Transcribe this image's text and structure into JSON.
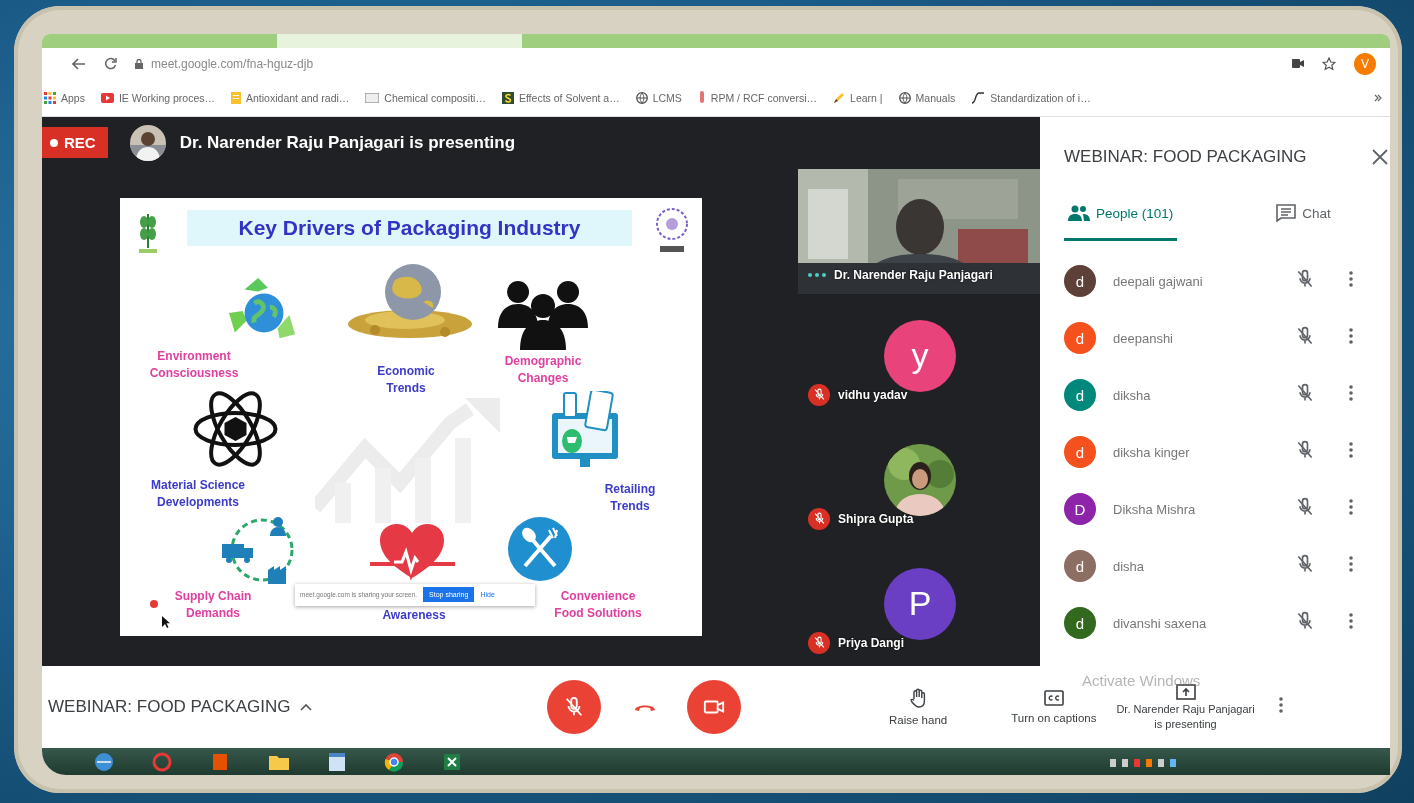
{
  "browser": {
    "address": "meet.google.com/fna-hguz-djb",
    "profile_initial": "V",
    "bookmarks": [
      "Apps",
      "IE Working proces…",
      "Antioxidant and radi…",
      "Chemical compositi…",
      "Effects of Solvent a…",
      "LCMS",
      "RPM / RCF conversi…",
      "Learn |",
      "Manuals",
      "Standardization of i…"
    ]
  },
  "presentation": {
    "rec_label": "REC",
    "banner": "Dr. Narender Raju Panjagari is presenting"
  },
  "slide": {
    "title": "Key Drivers of Packaging Industry",
    "drivers": [
      {
        "label": "Environment\nConsciousness",
        "color": "#e0409f"
      },
      {
        "label": "Economic\nTrends",
        "color": "#3c3cc8"
      },
      {
        "label": "Demographic\nChanges",
        "color": "#e0409f"
      },
      {
        "label": "Material Science\nDevelopments",
        "color": "#3c3cc8"
      },
      {
        "label": "Retailing\nTrends",
        "color": "#3c3cc8"
      },
      {
        "label": "Supply Chain\nDemands",
        "color": "#e0409f"
      },
      {
        "label": "Awareness",
        "color": "#3c3cc8"
      },
      {
        "label": "Convenience\nFood Solutions",
        "color": "#e0409f"
      }
    ],
    "share_notice": {
      "message": "meet.google.com is sharing your screen.",
      "stop_button": "Stop sharing",
      "hide_button": "Hide"
    }
  },
  "tiles": [
    {
      "name": "Dr. Narender Raju Panjagari",
      "kind": "video",
      "muted": false
    },
    {
      "name": "vidhu yadav",
      "kind": "initial",
      "initial": "y",
      "color": "#e8437a",
      "muted": true
    },
    {
      "name": "Shipra Gupta",
      "muted": true
    },
    {
      "name": "Priya Dangi",
      "kind": "initial",
      "initial": "P",
      "color": "#6a3fc4",
      "muted": true
    }
  ],
  "panel": {
    "title": "WEBINAR: FOOD PACKAGING",
    "tabs": [
      {
        "label": "People (101)",
        "kind": "people",
        "selected": true
      },
      {
        "label": "Chat",
        "kind": "chat",
        "selected": false
      }
    ],
    "people": [
      {
        "initial": "d",
        "name": "deepali gajwani",
        "color": "#5d4037",
        "muted": true
      },
      {
        "initial": "d",
        "name": "deepanshi",
        "color": "#f4511e",
        "muted": true
      },
      {
        "initial": "d",
        "name": "diksha",
        "color": "#00897b",
        "muted": true
      },
      {
        "initial": "d",
        "name": "diksha kinger",
        "color": "#f4511e",
        "muted": true
      },
      {
        "initial": "D",
        "name": "Diksha Mishra",
        "color": "#8e24aa",
        "muted": true
      },
      {
        "initial": "d",
        "name": "disha",
        "color": "#8d6e63",
        "muted": true
      },
      {
        "initial": "d",
        "name": "divanshi saxena",
        "color": "#33691e",
        "muted": true
      }
    ]
  },
  "bottom_bar": {
    "meeting_name": "WEBINAR: FOOD PACKAGING",
    "mic_on": false,
    "camera_on": false,
    "actions": [
      {
        "kind": "hand",
        "label": "Raise hand"
      },
      {
        "kind": "captions",
        "label": "Turn on captions"
      }
    ],
    "presenting_name": "Dr. Narender Raju Panjagari",
    "presenting_status": "is presenting"
  },
  "windows_notice": "Activate Windows"
}
